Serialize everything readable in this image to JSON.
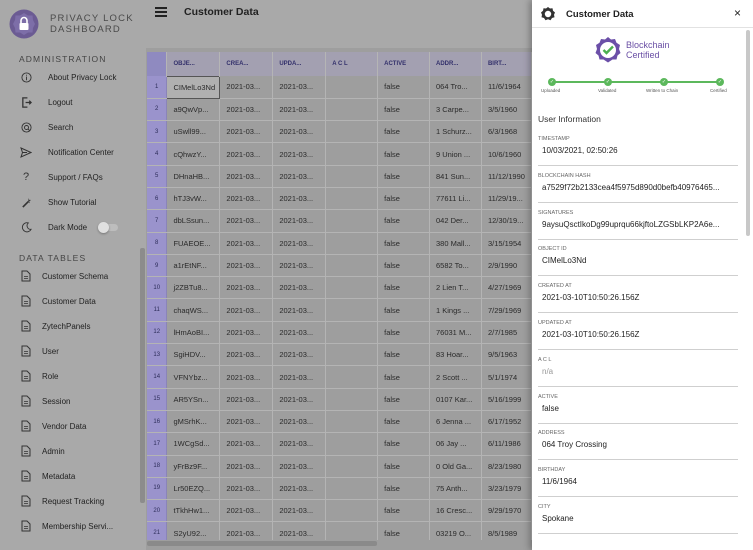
{
  "brand": {
    "line1": "PRIVACY LOCK",
    "line2": "DASHBOARD"
  },
  "sidebar": {
    "admin_title": "ADMINISTRATION",
    "admin_items": [
      {
        "label": "About Privacy Lock",
        "icon": "info-icon"
      },
      {
        "label": "Logout",
        "icon": "logout-icon"
      },
      {
        "label": "Search",
        "icon": "search-icon"
      },
      {
        "label": "Notification Center",
        "icon": "send-icon"
      },
      {
        "label": "Support / FAQs",
        "icon": "question-icon"
      },
      {
        "label": "Show Tutorial",
        "icon": "wand-icon"
      },
      {
        "label": "Dark Mode",
        "icon": "moon-icon"
      }
    ],
    "tables_title": "DATA TABLES",
    "table_items": [
      "Customer Schema",
      "Customer Data",
      "ZytechPanels",
      "User",
      "Role",
      "Session",
      "Vendor Data",
      "Admin",
      "Metadata",
      "Request Tracking",
      "Membership Servi..."
    ]
  },
  "header": {
    "title": "Customer Data"
  },
  "grid": {
    "columns": [
      "OBJE...",
      "CREA...",
      "UPDA...",
      "A C L",
      "ACTIVE",
      "ADDR...",
      "BIRT..."
    ],
    "rows": [
      [
        "1",
        "CIMelLo3Nd",
        "2021-03...",
        "2021-03...",
        "",
        "false",
        "064 Tro...",
        "11/6/1964"
      ],
      [
        "2",
        "a9QwVp...",
        "2021-03...",
        "2021-03...",
        "",
        "false",
        "3 Carpe...",
        "3/5/1960"
      ],
      [
        "3",
        "uSwll99...",
        "2021-03...",
        "2021-03...",
        "",
        "false",
        "1 Schurz...",
        "6/3/1968"
      ],
      [
        "4",
        "cQhwzY...",
        "2021-03...",
        "2021-03...",
        "",
        "false",
        "9 Union ...",
        "10/6/1960"
      ],
      [
        "5",
        "DHnaHB...",
        "2021-03...",
        "2021-03...",
        "",
        "false",
        "841 Sun...",
        "11/12/1990"
      ],
      [
        "6",
        "hTJ3vW...",
        "2021-03...",
        "2021-03...",
        "",
        "false",
        "77611 Li...",
        "11/29/19..."
      ],
      [
        "7",
        "dbLSsun...",
        "2021-03...",
        "2021-03...",
        "",
        "false",
        "042 Der...",
        "12/30/19..."
      ],
      [
        "8",
        "FUAEOE...",
        "2021-03...",
        "2021-03...",
        "",
        "false",
        "380 Mall...",
        "3/15/1954"
      ],
      [
        "9",
        "a1rEtNF...",
        "2021-03...",
        "2021-03...",
        "",
        "false",
        "6582 To...",
        "2/9/1990"
      ],
      [
        "10",
        "j2ZBTu8...",
        "2021-03...",
        "2021-03...",
        "",
        "false",
        "2 Lien T...",
        "4/27/1969"
      ],
      [
        "11",
        "chaqWS...",
        "2021-03...",
        "2021-03...",
        "",
        "false",
        "1 Kings ...",
        "7/29/1969"
      ],
      [
        "12",
        "lHmAoBI...",
        "2021-03...",
        "2021-03...",
        "",
        "false",
        "76031 M...",
        "2/7/1985"
      ],
      [
        "13",
        "SgiHDV...",
        "2021-03...",
        "2021-03...",
        "",
        "false",
        "83 Hoar...",
        "9/5/1963"
      ],
      [
        "14",
        "VFNYbz...",
        "2021-03...",
        "2021-03...",
        "",
        "false",
        "2 Scott ...",
        "5/1/1974"
      ],
      [
        "15",
        "AR5YSn...",
        "2021-03...",
        "2021-03...",
        "",
        "false",
        "0107 Kar...",
        "5/16/1999"
      ],
      [
        "16",
        "gMSrhK...",
        "2021-03...",
        "2021-03...",
        "",
        "false",
        "6 Jenna ...",
        "6/17/1952"
      ],
      [
        "17",
        "1WCgSd...",
        "2021-03...",
        "2021-03...",
        "",
        "false",
        "06 Jay ...",
        "6/11/1986"
      ],
      [
        "18",
        "yFrBz9F...",
        "2021-03...",
        "2021-03...",
        "",
        "false",
        "0 Old Ga...",
        "8/23/1980"
      ],
      [
        "19",
        "Lr50EZQ...",
        "2021-03...",
        "2021-03...",
        "",
        "false",
        "75 Anth...",
        "3/23/1979"
      ],
      [
        "20",
        "tTkhHw1...",
        "2021-03...",
        "2021-03...",
        "",
        "false",
        "16 Cresc...",
        "9/29/1970"
      ],
      [
        "21",
        "S2yU92...",
        "2021-03...",
        "2021-03...",
        "",
        "false",
        "03219 O...",
        "8/5/1989"
      ]
    ]
  },
  "drawer": {
    "title": "Customer Data",
    "close": "×",
    "cert": {
      "line1": "Blockchain",
      "line2": "Certified"
    },
    "steps": [
      "Uploaded",
      "Validated",
      "Written to Chain",
      "Certified"
    ],
    "section": "User Information",
    "fields": [
      {
        "key": "TIMESTAMP",
        "value": "10/03/2021, 02:50:26"
      },
      {
        "key": "Blockchain Hash",
        "value": "a7529f72b2133cea4f5975d890d0befb40976465..."
      },
      {
        "key": "SIGNATURES",
        "value": "9aysuQsctIkoDg99uprqu66kjftoLZGSbLKP2A6e..."
      },
      {
        "key": "OBJECT ID",
        "value": "CIMelLo3Nd"
      },
      {
        "key": "CREATED AT",
        "value": "2021-03-10T10:50:26.156Z"
      },
      {
        "key": "UPDATED AT",
        "value": "2021-03-10T10:50:26.156Z"
      },
      {
        "key": "A C L",
        "value": "n/a"
      },
      {
        "key": "ACTIVE",
        "value": "false"
      },
      {
        "key": "ADDRESS",
        "value": "064 Troy Crossing"
      },
      {
        "key": "BIRTHDAY",
        "value": "11/6/1964"
      },
      {
        "key": "CITY",
        "value": "Spokane"
      }
    ]
  }
}
